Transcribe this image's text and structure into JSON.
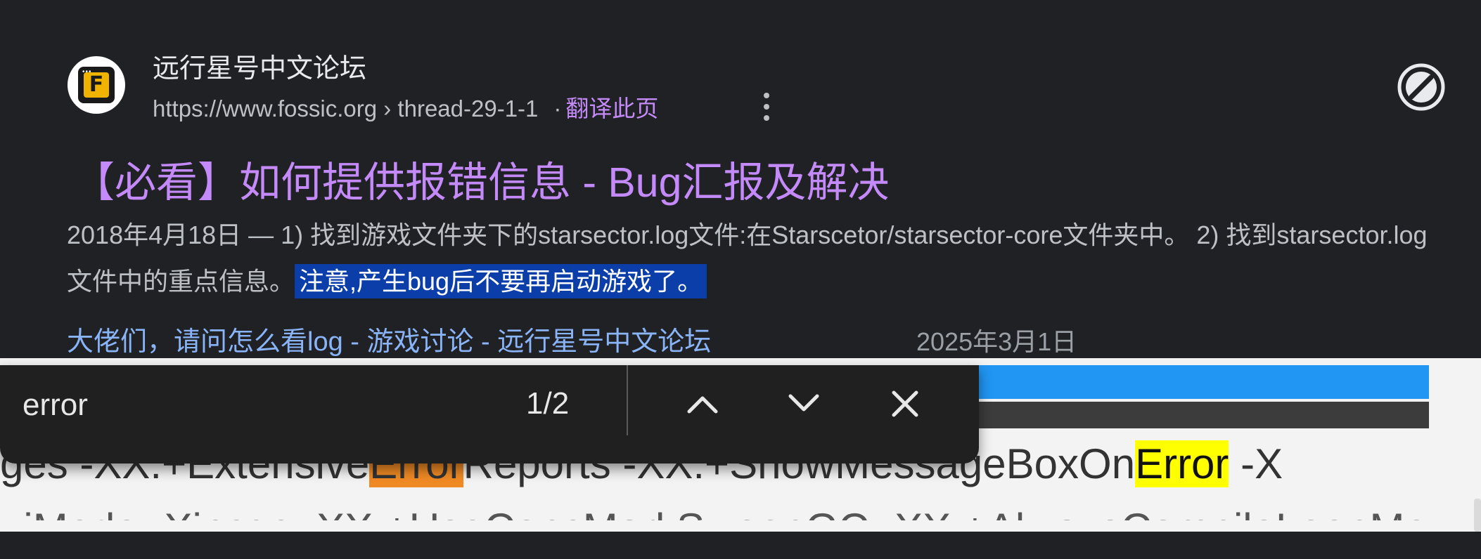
{
  "result": {
    "site_name": "远行星号中文论坛",
    "url": "https://www.fossic.org › thread-29-1-1",
    "separator": "·",
    "translate_label": "翻译此页",
    "title": "【必看】如何提供报错信息 - Bug汇报及解决",
    "snippet_text": "2018年4月18日 — 1) 找到游戏文件夹下的starsector.log文件:在Starscetor/starsector-core文件夹中。 2) 找到starsector.log文件中的重点信息。",
    "snippet_highlight": "注意,产生bug后不要再启动游戏了。",
    "related_link": "大佬们，请问怎么看log - 游戏讨论 - 远行星号中文论坛",
    "related_date": "2025年3月1日",
    "favicon_letter": "F"
  },
  "log": {
    "line1_pre": "ges -XX:+Extensive",
    "line1_match_current": "Error",
    "line1_mid": "Reports -XX:+ShowMessageBoxOn",
    "line1_match_other": "Error",
    "line1_post": " -X",
    "line2": "uiMode -Xincgc -XX:+UseConcMarkSweepGC -XX:+AlwaysCompileLoopMethods"
  },
  "findbar": {
    "query": "error",
    "count": "1/2",
    "prev_icon": "chevron-up-icon",
    "next_icon": "chevron-down-icon",
    "close_icon": "close-icon"
  },
  "colors": {
    "page_bg": "#202124",
    "title_link": "#c58af9",
    "related_link": "#8ab4f8",
    "selection": "#0b3ea8",
    "current_match": "#f08a24",
    "other_match": "#ffff00",
    "findbar_bg": "#202020"
  }
}
